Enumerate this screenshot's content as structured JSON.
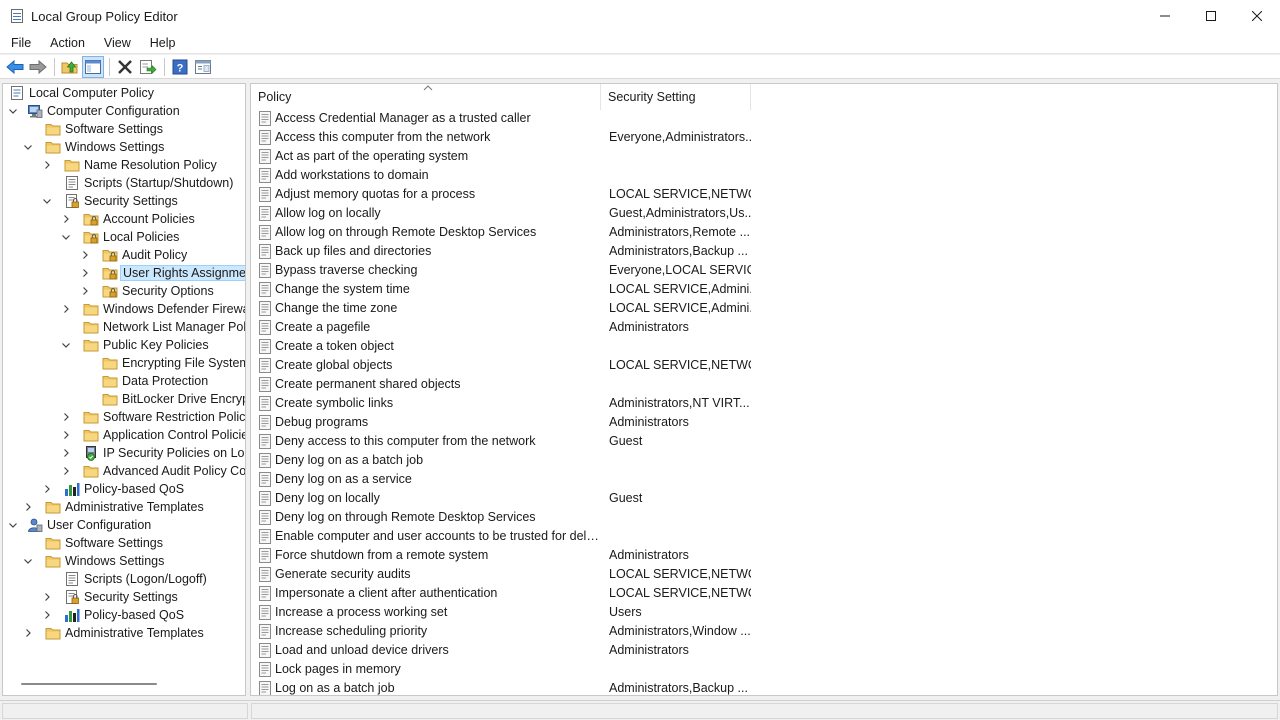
{
  "window": {
    "title": "Local Group Policy Editor"
  },
  "menu": [
    "File",
    "Action",
    "View",
    "Help"
  ],
  "toolbar": [
    "back-icon",
    "forward-icon",
    "up-folder-icon",
    "show-hide-console-tree-icon",
    "delete-icon",
    "export-list-icon",
    "help-icon",
    "properties-icon"
  ],
  "tree": [
    {
      "label": "Local Computer Policy",
      "level": 0,
      "chevron": "none",
      "icon": "policy"
    },
    {
      "label": "Computer Configuration",
      "level": 0,
      "chevron": "down",
      "icon": "computer"
    },
    {
      "label": "Software Settings",
      "level": 1,
      "chevron": "none",
      "icon": "folder"
    },
    {
      "label": "Windows Settings",
      "level": 1,
      "chevron": "down",
      "icon": "folder"
    },
    {
      "label": "Name Resolution Policy",
      "level": 2,
      "chevron": "right",
      "icon": "folder"
    },
    {
      "label": "Scripts (Startup/Shutdown)",
      "level": 2,
      "chevron": "none",
      "icon": "script"
    },
    {
      "label": "Security Settings",
      "level": 2,
      "chevron": "down",
      "icon": "security"
    },
    {
      "label": "Account Policies",
      "level": 3,
      "chevron": "right",
      "icon": "lockfolder"
    },
    {
      "label": "Local Policies",
      "level": 3,
      "chevron": "down",
      "icon": "lockfolder"
    },
    {
      "label": "Audit Policy",
      "level": 4,
      "chevron": "right",
      "icon": "lockfolder"
    },
    {
      "label": "User Rights Assignment",
      "level": 4,
      "chevron": "right",
      "icon": "lockfolder",
      "selected": true
    },
    {
      "label": "Security Options",
      "level": 4,
      "chevron": "right",
      "icon": "lockfolder"
    },
    {
      "label": "Windows Defender Firewall",
      "level": 3,
      "chevron": "right",
      "icon": "folder"
    },
    {
      "label": "Network List Manager Polic",
      "level": 3,
      "chevron": "none",
      "icon": "folder"
    },
    {
      "label": "Public Key Policies",
      "level": 3,
      "chevron": "down",
      "icon": "folder"
    },
    {
      "label": "Encrypting File System",
      "level": 4,
      "chevron": "none",
      "icon": "folder"
    },
    {
      "label": "Data Protection",
      "level": 4,
      "chevron": "none",
      "icon": "folder"
    },
    {
      "label": "BitLocker Drive Encrypt",
      "level": 4,
      "chevron": "none",
      "icon": "folder"
    },
    {
      "label": "Software Restriction Policie",
      "level": 3,
      "chevron": "right",
      "icon": "folder"
    },
    {
      "label": "Application Control Policie",
      "level": 3,
      "chevron": "right",
      "icon": "folder"
    },
    {
      "label": "IP Security Policies on Loca",
      "level": 3,
      "chevron": "right",
      "icon": "ipsec"
    },
    {
      "label": "Advanced Audit Policy Cor",
      "level": 3,
      "chevron": "right",
      "icon": "folder"
    },
    {
      "label": "Policy-based QoS",
      "level": 2,
      "chevron": "right",
      "icon": "chart"
    },
    {
      "label": "Administrative Templates",
      "level": 1,
      "chevron": "right",
      "icon": "folder"
    },
    {
      "label": "User Configuration",
      "level": 0,
      "chevron": "down",
      "icon": "user"
    },
    {
      "label": "Software Settings",
      "level": 1,
      "chevron": "none",
      "icon": "folder"
    },
    {
      "label": "Windows Settings",
      "level": 1,
      "chevron": "down",
      "icon": "folder"
    },
    {
      "label": "Scripts (Logon/Logoff)",
      "level": 2,
      "chevron": "none",
      "icon": "script"
    },
    {
      "label": "Security Settings",
      "level": 2,
      "chevron": "right",
      "icon": "security"
    },
    {
      "label": "Policy-based QoS",
      "level": 2,
      "chevron": "right",
      "icon": "chart"
    },
    {
      "label": "Administrative Templates",
      "level": 1,
      "chevron": "right",
      "icon": "folder"
    }
  ],
  "list": {
    "columns": {
      "policy": "Policy",
      "setting": "Security Setting"
    },
    "rows": [
      {
        "policy": "Access Credential Manager as a trusted caller",
        "setting": ""
      },
      {
        "policy": "Access this computer from the network",
        "setting": "Everyone,Administrators..."
      },
      {
        "policy": "Act as part of the operating system",
        "setting": ""
      },
      {
        "policy": "Add workstations to domain",
        "setting": ""
      },
      {
        "policy": "Adjust memory quotas for a process",
        "setting": "LOCAL SERVICE,NETWO..."
      },
      {
        "policy": "Allow log on locally",
        "setting": "Guest,Administrators,Us..."
      },
      {
        "policy": "Allow log on through Remote Desktop Services",
        "setting": "Administrators,Remote ..."
      },
      {
        "policy": "Back up files and directories",
        "setting": "Administrators,Backup ..."
      },
      {
        "policy": "Bypass traverse checking",
        "setting": "Everyone,LOCAL SERVIC..."
      },
      {
        "policy": "Change the system time",
        "setting": "LOCAL SERVICE,Admini..."
      },
      {
        "policy": "Change the time zone",
        "setting": "LOCAL SERVICE,Admini..."
      },
      {
        "policy": "Create a pagefile",
        "setting": "Administrators"
      },
      {
        "policy": "Create a token object",
        "setting": ""
      },
      {
        "policy": "Create global objects",
        "setting": "LOCAL SERVICE,NETWO..."
      },
      {
        "policy": "Create permanent shared objects",
        "setting": ""
      },
      {
        "policy": "Create symbolic links",
        "setting": "Administrators,NT VIRT..."
      },
      {
        "policy": "Debug programs",
        "setting": "Administrators"
      },
      {
        "policy": "Deny access to this computer from the network",
        "setting": "Guest"
      },
      {
        "policy": "Deny log on as a batch job",
        "setting": ""
      },
      {
        "policy": "Deny log on as a service",
        "setting": ""
      },
      {
        "policy": "Deny log on locally",
        "setting": "Guest"
      },
      {
        "policy": "Deny log on through Remote Desktop Services",
        "setting": ""
      },
      {
        "policy": "Enable computer and user accounts to be trusted for delega...",
        "setting": ""
      },
      {
        "policy": "Force shutdown from a remote system",
        "setting": "Administrators"
      },
      {
        "policy": "Generate security audits",
        "setting": "LOCAL SERVICE,NETWO..."
      },
      {
        "policy": "Impersonate a client after authentication",
        "setting": "LOCAL SERVICE,NETWO..."
      },
      {
        "policy": "Increase a process working set",
        "setting": "Users"
      },
      {
        "policy": "Increase scheduling priority",
        "setting": "Administrators,Window ..."
      },
      {
        "policy": "Load and unload device drivers",
        "setting": "Administrators"
      },
      {
        "policy": "Lock pages in memory",
        "setting": ""
      },
      {
        "policy": "Log on as a batch job",
        "setting": "Administrators,Backup ..."
      }
    ]
  },
  "colors": {
    "selection_bg": "#cce8ff",
    "selection_border": "#99d1ff",
    "folder": "#f2c660",
    "accent_blue": "#3a7bd5"
  }
}
